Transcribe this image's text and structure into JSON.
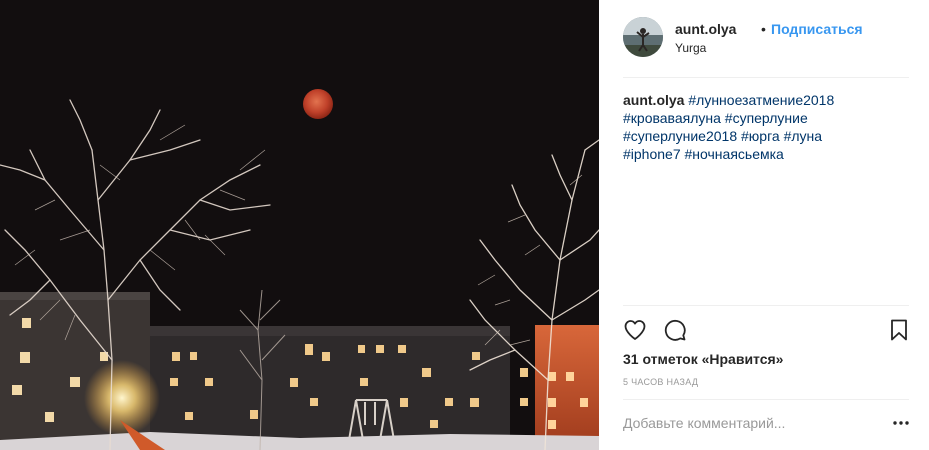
{
  "post": {
    "username": "aunt.olya",
    "separator": "•",
    "follow_label": "Подписаться",
    "location": "Yurga",
    "caption": {
      "username": "aunt.olya",
      "hashtags": [
        "#лунноезатмение2018",
        "#кроваваялуна",
        "#суперлуние",
        "#суперлуние2018",
        "#юрга",
        "#луна",
        "#iphone7",
        "#ночнаясьемка"
      ]
    },
    "likes_text": "31 отметок «Нравится»",
    "time_text": "5 часов назад",
    "comment_placeholder": "Добавьте комментарий...",
    "icons": {
      "like": "heart-icon",
      "comment": "comment-bubble-icon",
      "save": "bookmark-icon",
      "more": "more-options-icon"
    },
    "colors": {
      "link": "#3897f0",
      "hashtag": "#003569",
      "text": "#262626",
      "muted": "#999999",
      "photo_sky": "#110d0e",
      "moon": "#c0412a"
    }
  }
}
